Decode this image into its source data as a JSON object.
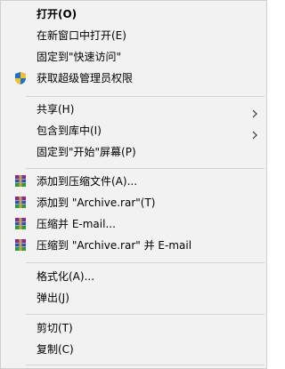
{
  "menu": {
    "items": [
      {
        "label": "打开(O)"
      },
      {
        "label": "在新窗口中打开(E)"
      },
      {
        "label": "固定到\"快速访问\""
      },
      {
        "label": "获取超级管理员权限",
        "icon": "uac-shield-icon"
      },
      {
        "label": "共享(H)",
        "submenu": true
      },
      {
        "label": "包含到库中(I)",
        "submenu": true
      },
      {
        "label": "固定到\"开始\"屏幕(P)"
      },
      {
        "label": "添加到压缩文件(A)...",
        "icon": "winrar-icon"
      },
      {
        "label": "添加到 \"Archive.rar\"(T)",
        "icon": "winrar-icon"
      },
      {
        "label": "压缩并 E-mail...",
        "icon": "winrar-icon"
      },
      {
        "label": "压缩到 \"Archive.rar\" 并 E-mail",
        "icon": "winrar-icon"
      },
      {
        "label": "格式化(A)..."
      },
      {
        "label": "弹出(J)"
      },
      {
        "label": "剪切(T)"
      },
      {
        "label": "复制(C)"
      }
    ]
  },
  "colors": {
    "menu_bg": "#f2f2f2",
    "separator": "#d4d4d4",
    "shield_blue": "#1f6fd6",
    "shield_yellow": "#f2c318"
  }
}
